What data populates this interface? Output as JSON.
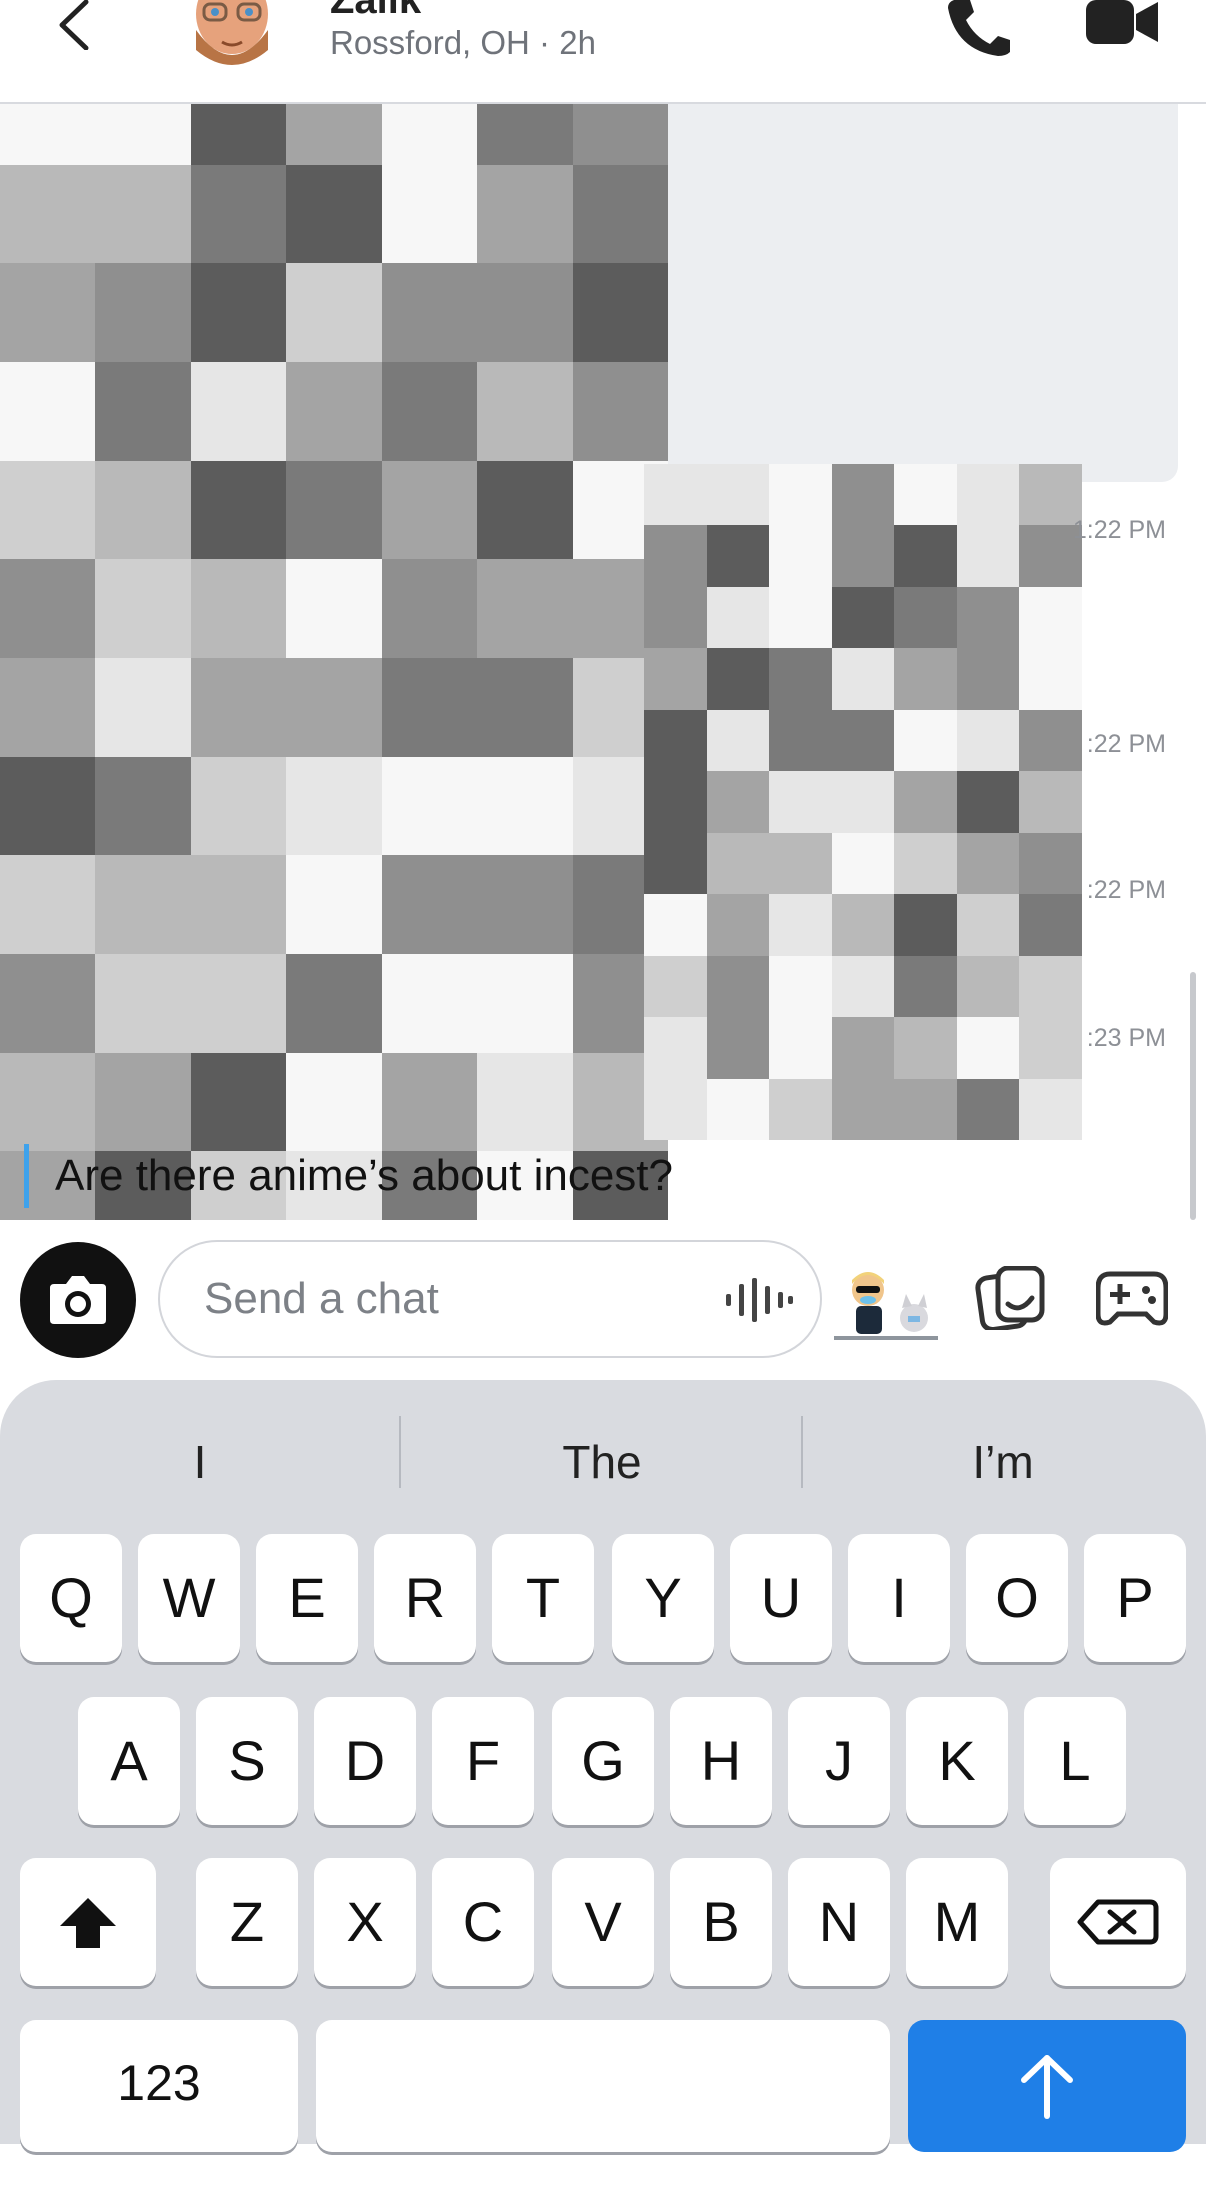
{
  "header": {
    "contact_name": "Zalik",
    "subtitle": "Rossford, OH · 2h",
    "icons": {
      "back": "chevron-left-icon",
      "call": "phone-icon",
      "video": "video-camera-icon"
    }
  },
  "chat": {
    "timestamps": [
      "1:22 PM",
      ":22 PM",
      ":22 PM",
      ":23 PM"
    ],
    "last_message": "Are there anime’s about incest?",
    "accent_color": "#3ea2ec"
  },
  "input": {
    "placeholder": "Send a chat",
    "icons": {
      "camera": "camera-icon",
      "mic": "voice-wave-icon",
      "bitmoji": "bitmoji-sticker",
      "stickers": "sticker-card-icon",
      "games": "gamepad-icon"
    }
  },
  "keyboard": {
    "suggestions": [
      "I",
      "The",
      "I’m"
    ],
    "row1": [
      "Q",
      "W",
      "E",
      "R",
      "T",
      "Y",
      "U",
      "I",
      "O",
      "P"
    ],
    "row2": [
      "A",
      "S",
      "D",
      "F",
      "G",
      "H",
      "J",
      "K",
      "L"
    ],
    "row3": [
      "Z",
      "X",
      "C",
      "V",
      "B",
      "N",
      "M"
    ],
    "numbers_label": "123",
    "send_color": "#1f7fe7"
  }
}
